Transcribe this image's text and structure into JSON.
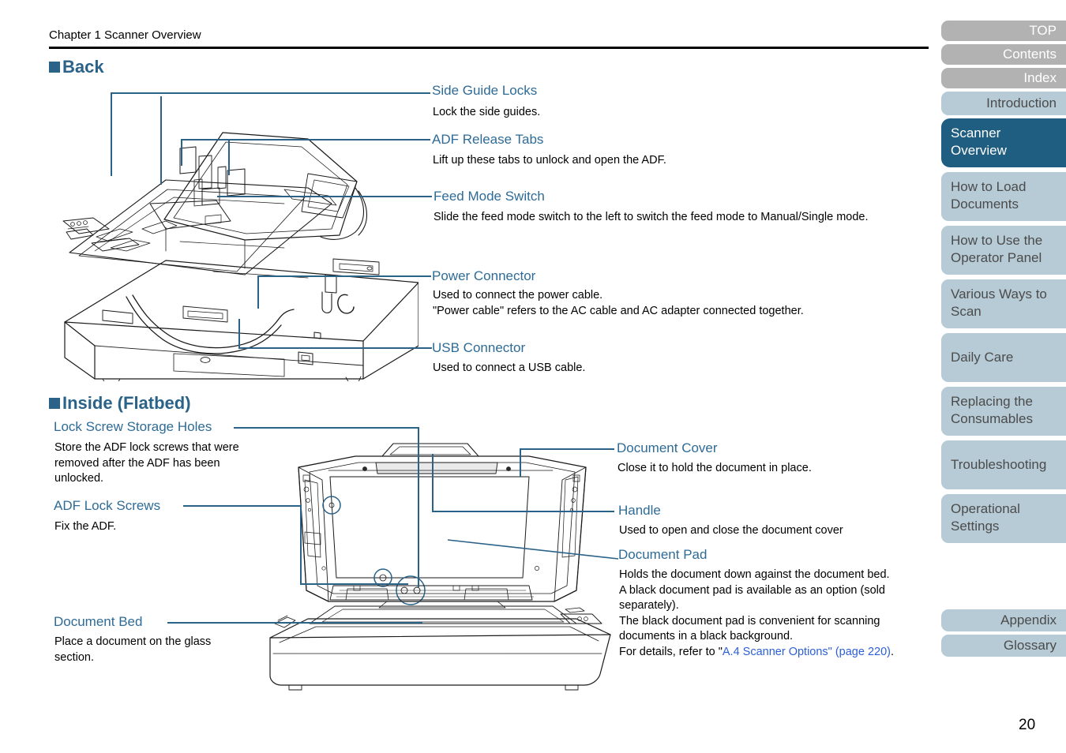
{
  "header": {
    "chapter": "Chapter 1 Scanner Overview"
  },
  "sections": {
    "back": {
      "title": "Back",
      "callouts": [
        {
          "label": "Side Guide Locks",
          "desc": "Lock the side guides."
        },
        {
          "label": "ADF Release Tabs",
          "desc": "Lift up these tabs to unlock and open the ADF."
        },
        {
          "label": "Feed Mode Switch",
          "desc": "Slide the feed mode switch to the left to switch the feed mode to Manual/Single mode."
        },
        {
          "label": "Power Connector",
          "desc_line1": "Used to connect the power cable.",
          "desc_line2": "\"Power cable\" refers to the AC cable and AC adapter connected together."
        },
        {
          "label": "USB Connector",
          "desc": "Used to connect a USB cable."
        }
      ]
    },
    "inside": {
      "title": "Inside (Flatbed)",
      "left_callouts": [
        {
          "label": "Lock Screw Storage Holes",
          "desc_line1": "Store the ADF lock screws that were",
          "desc_line2": "removed after the ADF has been",
          "desc_line3": "unlocked."
        },
        {
          "label": "ADF Lock Screws",
          "desc": "Fix the ADF."
        },
        {
          "label": "Document Bed",
          "desc_line1": "Place a document on the glass",
          "desc_line2": "section."
        }
      ],
      "right_callouts": [
        {
          "label": "Document Cover",
          "desc": "Close it to hold the document in place."
        },
        {
          "label": "Handle",
          "desc": "Used to open and close the document cover"
        },
        {
          "label": "Document Pad",
          "desc_line1": "Holds the document down against the document bed.",
          "desc_line2": "A black document pad is available as an option (sold",
          "desc_line3": "separately).",
          "desc_line4": "The black document pad is convenient for scanning",
          "desc_line5": "documents in a black background.",
          "desc_line6_pre": "For details, refer to \"",
          "desc_line6_link": "A.4 Scanner Options\" (page 220)",
          "desc_line6_post": "."
        }
      ]
    }
  },
  "sidebar": {
    "items": [
      {
        "label": "TOP",
        "style": "gray"
      },
      {
        "label": "Contents",
        "style": "gray"
      },
      {
        "label": "Index",
        "style": "gray"
      },
      {
        "label": "Introduction",
        "style": "pale"
      },
      {
        "label": "Scanner Overview",
        "style": "active"
      },
      {
        "label": "How to Load Documents",
        "style": "pale"
      },
      {
        "label": "How to Use the Operator Panel",
        "style": "pale"
      },
      {
        "label": "Various Ways to Scan",
        "style": "pale"
      },
      {
        "label": "Daily Care",
        "style": "pale"
      },
      {
        "label": "Replacing the Consumables",
        "style": "pale"
      },
      {
        "label": "Troubleshooting",
        "style": "pale"
      },
      {
        "label": "Operational Settings",
        "style": "pale"
      },
      {
        "label": "Appendix",
        "style": "pale"
      },
      {
        "label": "Glossary",
        "style": "pale"
      }
    ]
  },
  "footer": {
    "page_number": "20"
  },
  "colors": {
    "accent": "#2a6288",
    "label": "#2e6b96",
    "active_tab": "#1f5e80",
    "pale_tab": "#b7cbd6",
    "gray_tab": "#b2b2b2",
    "link": "#2b5fd9"
  }
}
